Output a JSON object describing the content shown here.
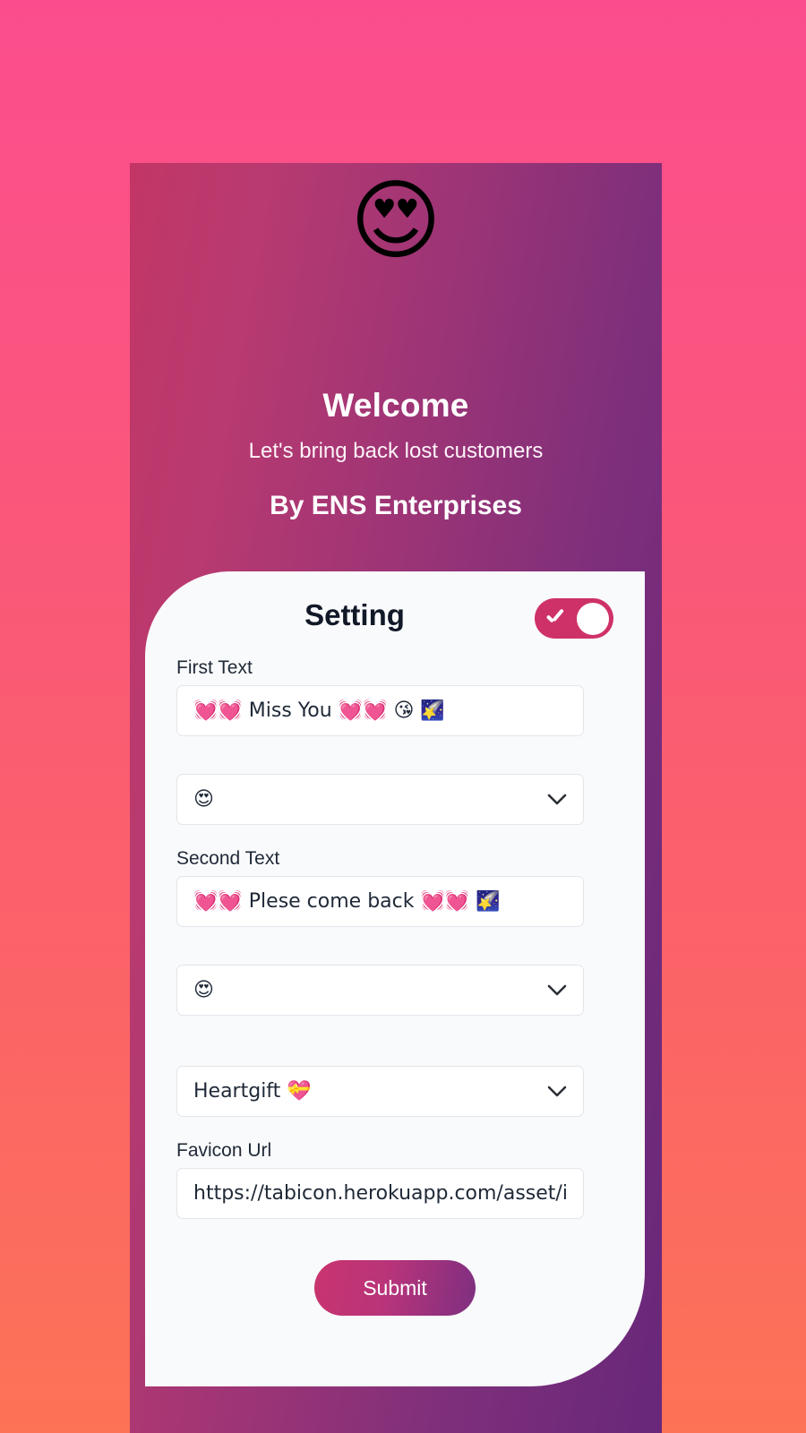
{
  "background": {
    "outer_gradient_from": "#fb4d8d",
    "outer_gradient_to": "#fd7356",
    "device_gradient_from": "#c23666",
    "device_gradient_to": "#68277a"
  },
  "hero": {
    "emoji": "😍",
    "emoji_name": "smiling-face-with-heart-eyes",
    "title": "Welcome",
    "subtitle": "Let's bring back lost customers",
    "brand": "By ENS Enterprises"
  },
  "card": {
    "title": "Setting",
    "toggle": {
      "state": "on",
      "accent_color": "#ce3168"
    },
    "fields": [
      {
        "label": "First Text",
        "type": "text",
        "value": "💓💓 Miss You 💓💓 😘 🌠"
      },
      {
        "label": "",
        "type": "select",
        "value": "😍"
      },
      {
        "label": "Second Text",
        "type": "text",
        "value": "💓💓 Plese come back 💓💓 🌠"
      },
      {
        "label": "",
        "type": "select",
        "value": "😍"
      },
      {
        "label": "",
        "type": "select",
        "value": "Heartgift 💝"
      },
      {
        "label": "Favicon Url",
        "type": "text",
        "value": "https://tabicon.herokuapp.com/asset/ir"
      }
    ],
    "submit_label": "Submit"
  }
}
